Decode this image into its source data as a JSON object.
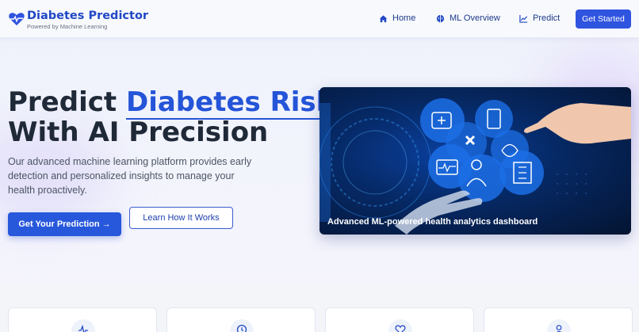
{
  "brand": {
    "title": "Diabetes Predictor",
    "subtitle": "Powered by Machine Learning",
    "icon": "heartbeat-icon"
  },
  "nav": {
    "items": [
      {
        "label": "Home",
        "icon": "home-icon"
      },
      {
        "label": "ML Overview",
        "icon": "brain-icon"
      },
      {
        "label": "Predict",
        "icon": "chart-line-icon"
      }
    ],
    "cta_label": "Get Started"
  },
  "hero": {
    "headline_part1": "Predict ",
    "headline_accent": "Diabetes Risk",
    "headline_line2": "With AI Precision",
    "lead": "Our advanced machine learning platform provides early detection and personalized insights to manage your health proactively.",
    "primary_button": "Get Your Prediction →",
    "secondary_button": "Learn How It Works",
    "image_caption": "Advanced ML-powered health analytics dashboard"
  },
  "feature_cards": [
    {
      "icon": "activity-icon"
    },
    {
      "icon": "clock-icon"
    },
    {
      "icon": "heart-icon"
    },
    {
      "icon": "user-icon"
    }
  ],
  "colors": {
    "brand": "#2148c4",
    "accent": "#2454d8",
    "button": "#2758dc"
  }
}
